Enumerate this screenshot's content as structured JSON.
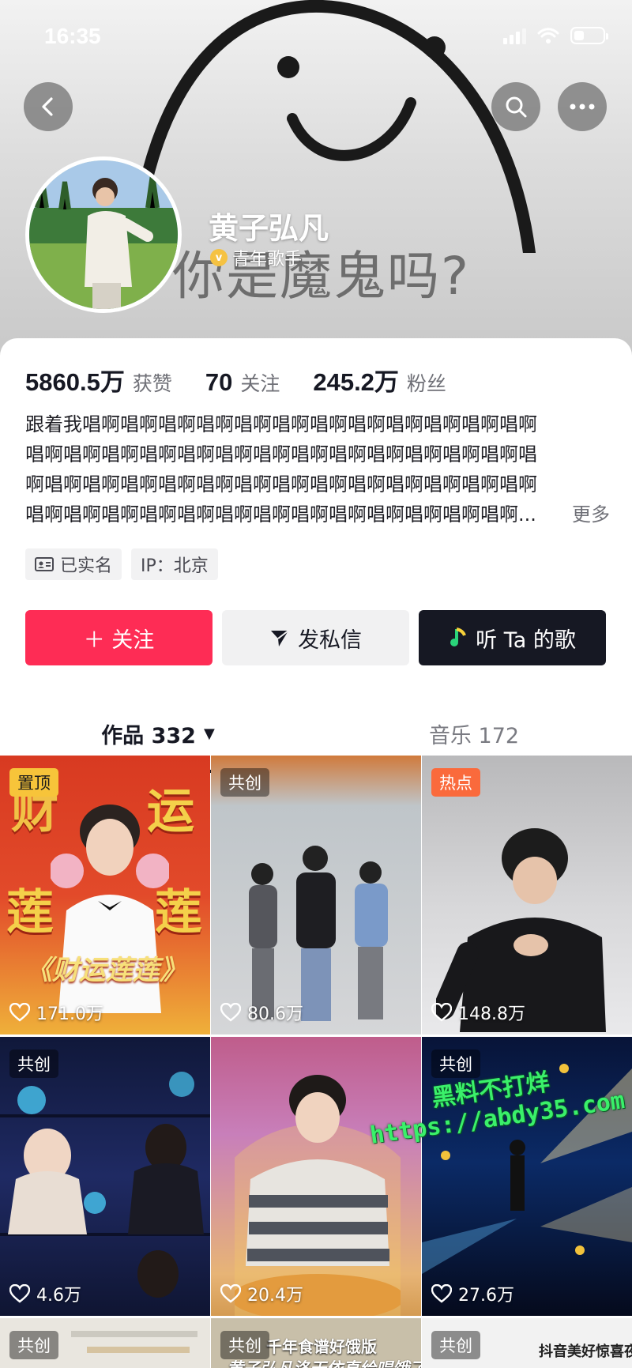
{
  "status_bar": {
    "time": "16:35"
  },
  "banner": {
    "caption": "你是魔鬼吗?"
  },
  "profile": {
    "name": "黄子弘凡",
    "verified_label": "青年歌手",
    "stats": [
      {
        "value": "5860.5万",
        "label": "获赞"
      },
      {
        "value": "70",
        "label": "关注"
      },
      {
        "value": "245.2万",
        "label": "粉丝"
      }
    ],
    "bio_lines": [
      "跟着我唱啊唱啊唱啊唱啊唱啊唱啊唱啊唱啊唱啊唱啊唱啊唱啊",
      "唱啊唱啊唱啊唱啊唱啊唱啊唱啊唱啊唱啊唱啊唱啊唱啊唱啊唱",
      "啊唱啊唱啊唱啊唱啊唱啊唱啊唱啊唱啊唱啊唱啊唱啊唱啊唱啊",
      "唱啊唱啊唱啊唱啊唱啊唱啊唱啊唱啊唱啊唱啊唱啊唱啊唱啊..."
    ],
    "bio_more": "更多",
    "tags": [
      {
        "icon": "id-card-icon",
        "label": "已实名"
      },
      {
        "label": "IP：北京"
      }
    ]
  },
  "actions": {
    "follow": "＋ 关注",
    "message": "发私信",
    "listen": "听 Ta 的歌"
  },
  "tabs": {
    "works": "作品 332",
    "music": "音乐 172"
  },
  "videos": [
    {
      "badge": "置顶",
      "badge_style": "yellow",
      "likes": "171.0万",
      "title": "《财运莲莲》",
      "chars": [
        "财",
        "运",
        "莲",
        "莲"
      ]
    },
    {
      "badge": "共创",
      "badge_style": "dark",
      "likes": "80.6万"
    },
    {
      "badge": "热点",
      "badge_style": "orange",
      "likes": "148.8万"
    },
    {
      "badge": "共创",
      "badge_style": "dark",
      "likes": "4.6万"
    },
    {
      "likes": "20.4万"
    },
    {
      "badge": "共创",
      "badge_style": "dark",
      "likes": "27.6万"
    },
    {
      "badge": "共创",
      "badge_style": "dark"
    },
    {
      "badge": "共创",
      "badge_style": "dark",
      "overlay": "千年食谱好饿版",
      "overlay2": "黄子弘凡洛天依直给唱饿了"
    },
    {
      "badge": "共创",
      "badge_style": "dark",
      "overlay": "抖音美好惊喜夜"
    }
  ],
  "watermark": {
    "line1": "黑料不打烊",
    "line2": "https://abdy35.com"
  }
}
